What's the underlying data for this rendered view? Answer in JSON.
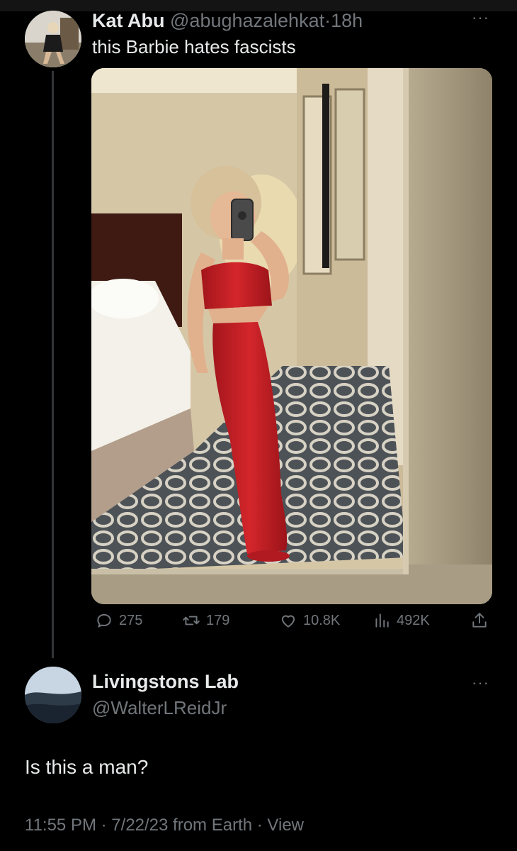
{
  "tweet": {
    "author_name": "Kat Abu",
    "author_handle": "@abughazalehkat",
    "separator": "·",
    "time": "18h",
    "text": "this Barbie hates fascists",
    "more": "···",
    "stats": {
      "replies": "275",
      "retweets": "179",
      "likes": "10.8K",
      "views": "492K"
    }
  },
  "reply": {
    "author_name": "Livingstons Lab",
    "author_handle": "@WalterLReidJr",
    "more": "···",
    "text": "Is this a man?",
    "time": "11:55 PM",
    "separator": "·",
    "date": "7/22/23 from Earth",
    "view_label": "View"
  },
  "colors": {
    "background": "#000000",
    "text": "#e7e9ea",
    "muted": "#71767b",
    "dress": "#c41e24"
  },
  "icons": [
    "reply-icon",
    "retweet-icon",
    "like-icon",
    "views-icon",
    "share-icon",
    "more-icon"
  ]
}
